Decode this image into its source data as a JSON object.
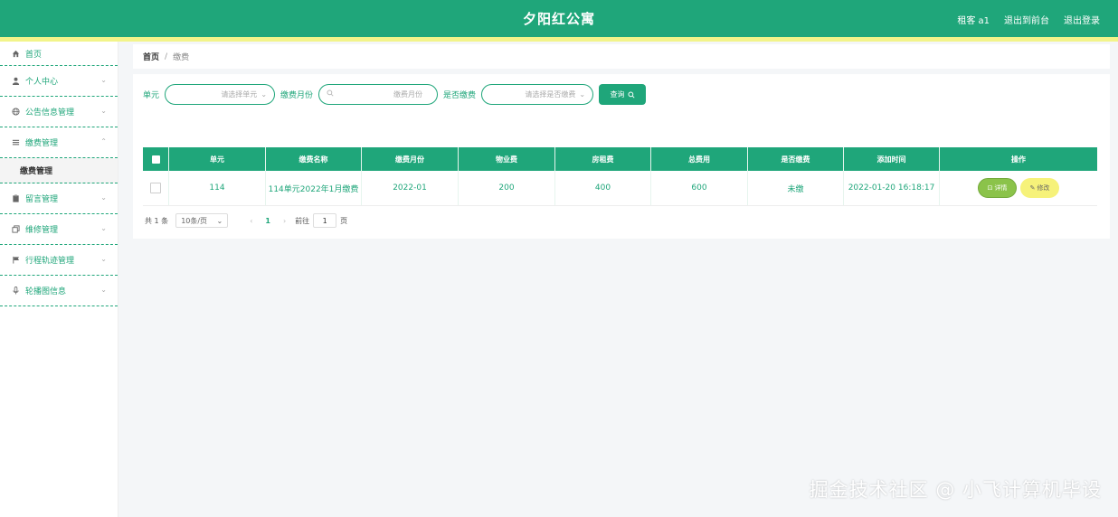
{
  "header": {
    "title": "夕阳红公寓",
    "user_label": "租客 a1",
    "back_label": "退出到前台",
    "logout_label": "退出登录"
  },
  "sidebar": {
    "items": [
      {
        "label": "首页",
        "icon": "home-icon"
      },
      {
        "label": "个人中心",
        "icon": "user-icon"
      },
      {
        "label": "公告信息管理",
        "icon": "globe-icon"
      },
      {
        "label": "缴费管理",
        "icon": "list-icon"
      },
      {
        "label": "留言管理",
        "icon": "clipboard-icon"
      },
      {
        "label": "维修管理",
        "icon": "copy-icon"
      },
      {
        "label": "行程轨迹管理",
        "icon": "flag-icon"
      },
      {
        "label": "轮播图信息",
        "icon": "mic-icon"
      }
    ],
    "sub_item": "缴费管理"
  },
  "breadcrumb": {
    "home": "首页",
    "separator": "/",
    "current": "缴费"
  },
  "search": {
    "unit_label": "单元",
    "unit_placeholder": "请选择单元",
    "month_label": "缴费月份",
    "month_placeholder": "缴费月份",
    "paid_label": "是否缴费",
    "paid_placeholder": "请选择是否缴费",
    "query_label": "查询"
  },
  "table": {
    "headers": [
      "单元",
      "缴费名称",
      "缴费月份",
      "物业费",
      "房租费",
      "总费用",
      "是否缴费",
      "添加时间",
      "操作"
    ],
    "rows": [
      {
        "unit": "114",
        "name": "114单元2022年1月缴费",
        "month": "2022-01",
        "property_fee": "200",
        "rent_fee": "400",
        "total": "600",
        "paid": "未缴",
        "created": "2022-01-20 16:18:17",
        "detail_label": "详情",
        "edit_label": "修改"
      }
    ]
  },
  "pager": {
    "total": "共 1 条",
    "page_size": "10条/页",
    "current_page": "1",
    "goto_label": "前往",
    "goto_value": "1",
    "page_unit": "页"
  },
  "watermark": "掘金技术社区 @ 小飞计算机毕设",
  "colors": {
    "primary": "#1fa67a",
    "stripe": "#f2f48a",
    "detail": "#8bc34a",
    "edit": "#f6f27a"
  }
}
